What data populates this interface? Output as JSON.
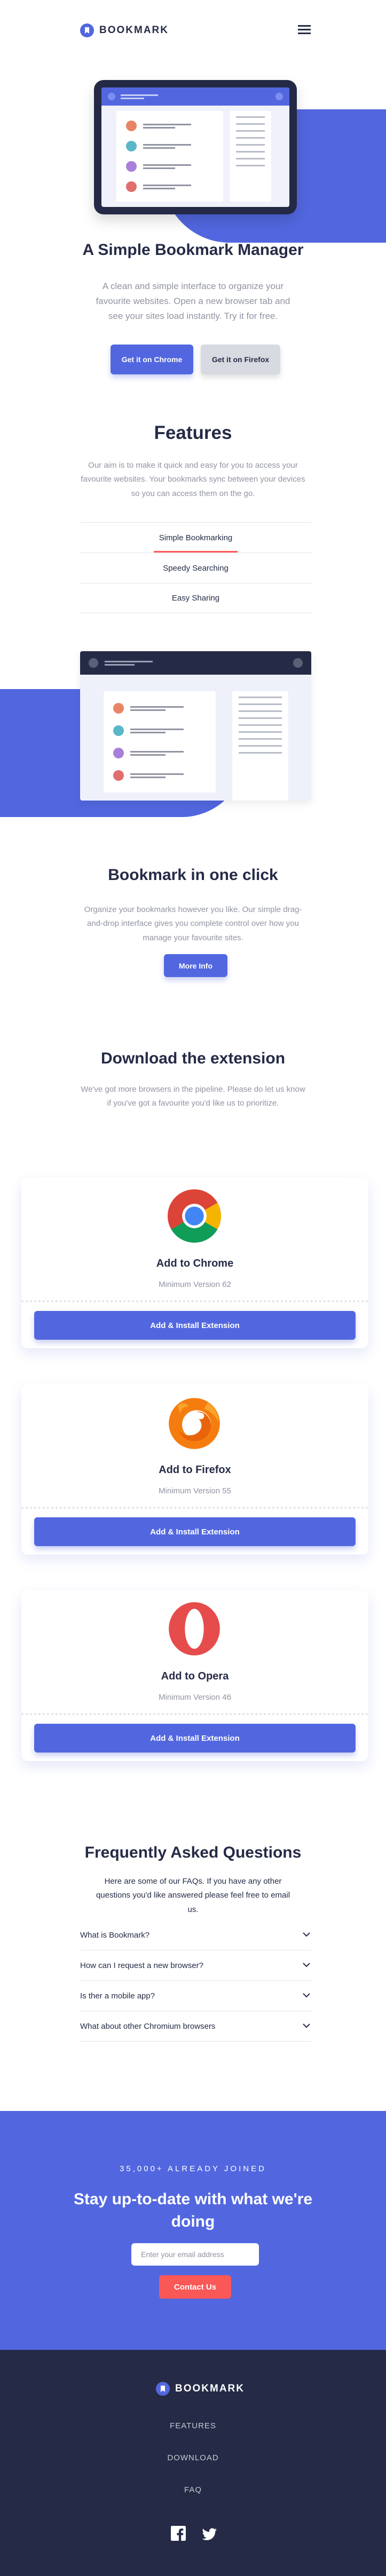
{
  "brand": {
    "name": "BOOKMARK",
    "accent": "#5267df",
    "secondary": "#fa5757",
    "dark": "#252b46"
  },
  "header": {
    "menu_icon": "hamburger-icon"
  },
  "hero": {
    "title": "A Simple Bookmark Manager",
    "text": "A clean and simple interface to organize your favourite websites. Open a new browser tab and see your sites load instantly. Try it for free.",
    "buttons": {
      "chrome": "Get it on Chrome",
      "firefox": "Get it on Firefox"
    }
  },
  "features": {
    "title": "Features",
    "text": "Our aim is to make it quick and easy for you to access your favourite websites. Your bookmarks sync between your devices so you can access them on the go.",
    "tabs": [
      {
        "label": "Simple Bookmarking",
        "active": true
      },
      {
        "label": "Speedy Searching",
        "active": false
      },
      {
        "label": "Easy Sharing",
        "active": false
      }
    ],
    "panel": {
      "title": "Bookmark in one click",
      "text": "Organize your bookmarks however you like. Our simple drag-and-drop interface gives you complete control over how you manage your favourite sites.",
      "button": "More Info"
    }
  },
  "download": {
    "title": "Download the extension",
    "text": "We've got more browsers in the pipeline. Please do let us know if you've got a favourite you'd like us to prioritize.",
    "cards": [
      {
        "title": "Add to Chrome",
        "version": "Minimum Version 62",
        "button": "Add & Install Extension",
        "icon": "chrome-logo-icon"
      },
      {
        "title": "Add to Firefox",
        "version": "Minimum Version 55",
        "button": "Add & Install Extension",
        "icon": "firefox-logo-icon"
      },
      {
        "title": "Add to Opera",
        "version": "Minimum Version 46",
        "button": "Add & Install Extension",
        "icon": "opera-logo-icon"
      }
    ]
  },
  "faq": {
    "title": "Frequently Asked Questions",
    "text": "Here are some of our FAQs. If you have any other questions you'd like answered please feel free to email us.",
    "items": [
      "What is Bookmark?",
      "How can I request a new browser?",
      "Is ther a mobile app?",
      "What about other Chromium browsers"
    ]
  },
  "cta": {
    "joined": "35,000+ ALREADY JOINED",
    "title": "Stay up-to-date with what we're doing",
    "placeholder": "Enter your email address",
    "button": "Contact Us"
  },
  "footer": {
    "links": [
      "FEATURES",
      "DOWNLOAD",
      "FAQ"
    ],
    "social": [
      "facebook-icon",
      "twitter-icon"
    ]
  }
}
